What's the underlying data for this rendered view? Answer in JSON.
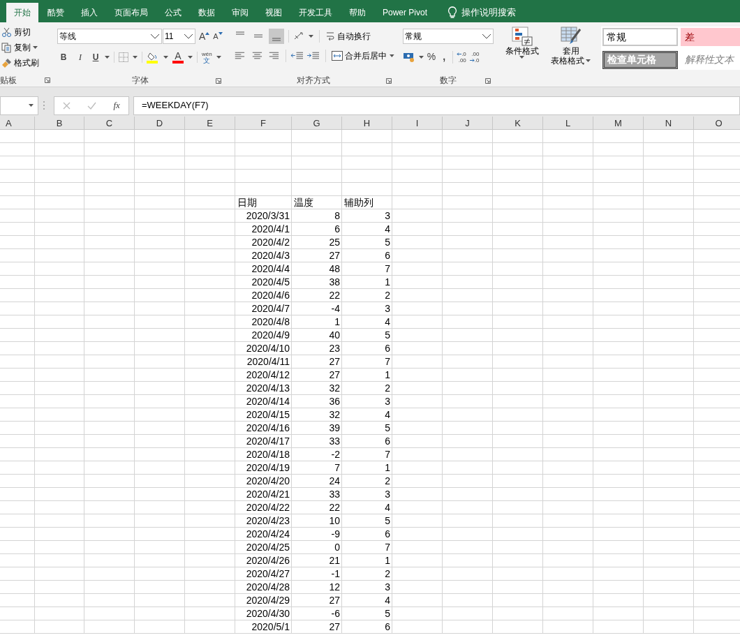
{
  "tabs": [
    {
      "label": "开始",
      "selected": true
    },
    {
      "label": "酷赞",
      "selected": false
    },
    {
      "label": "插入",
      "selected": false
    },
    {
      "label": "页面布局",
      "selected": false
    },
    {
      "label": "公式",
      "selected": false
    },
    {
      "label": "数据",
      "selected": false
    },
    {
      "label": "审阅",
      "selected": false
    },
    {
      "label": "视图",
      "selected": false
    },
    {
      "label": "开发工具",
      "selected": false
    },
    {
      "label": "帮助",
      "selected": false
    },
    {
      "label": "Power Pivot",
      "selected": false
    }
  ],
  "tell_me": "操作说明搜索",
  "clipboard": {
    "items": [
      "剪切",
      "复制",
      "格式刷"
    ],
    "label": "贴板"
  },
  "font": {
    "name": "等线",
    "size": "11",
    "grow": "A",
    "shrink": "A",
    "bold": "B",
    "italic": "I",
    "underline": "U",
    "font_color": "A",
    "phonetic_top": "wén",
    "phonetic_bottom": "文",
    "label": "字体"
  },
  "alignment": {
    "wrap": "自动换行",
    "merge": "合并后居中",
    "label": "对齐方式"
  },
  "number": {
    "format": "常规",
    "percent": "%",
    "comma": ",",
    "inc_top": ".0",
    "inc_bottom": ".00",
    "dec_top": ".00",
    "dec_bottom": ".0",
    "label": "数字"
  },
  "styles": {
    "conditional": "条件格式",
    "table_top": "套用",
    "table_bottom": "表格格式",
    "cells": [
      {
        "kind": "normal",
        "text": "常规"
      },
      {
        "kind": "bad",
        "text": "差"
      },
      {
        "kind": "check",
        "text": "检查单元格"
      },
      {
        "kind": "explanatory",
        "text": "解释性文本"
      }
    ]
  },
  "formula_bar": {
    "fx": "fx",
    "formula": "=WEEKDAY(F7)"
  },
  "columns": [
    "A",
    "B",
    "C",
    "D",
    "E",
    "F",
    "G",
    "H",
    "I",
    "J",
    "K",
    "L",
    "M",
    "N",
    "O"
  ],
  "header": [
    "日期",
    "温度",
    "辅助列"
  ],
  "rows": [
    [
      "2020/3/31",
      "8",
      "3"
    ],
    [
      "2020/4/1",
      "6",
      "4"
    ],
    [
      "2020/4/2",
      "25",
      "5"
    ],
    [
      "2020/4/3",
      "27",
      "6"
    ],
    [
      "2020/4/4",
      "48",
      "7"
    ],
    [
      "2020/4/5",
      "38",
      "1"
    ],
    [
      "2020/4/6",
      "22",
      "2"
    ],
    [
      "2020/4/7",
      "-4",
      "3"
    ],
    [
      "2020/4/8",
      "1",
      "4"
    ],
    [
      "2020/4/9",
      "40",
      "5"
    ],
    [
      "2020/4/10",
      "23",
      "6"
    ],
    [
      "2020/4/11",
      "27",
      "7"
    ],
    [
      "2020/4/12",
      "27",
      "1"
    ],
    [
      "2020/4/13",
      "32",
      "2"
    ],
    [
      "2020/4/14",
      "36",
      "3"
    ],
    [
      "2020/4/15",
      "32",
      "4"
    ],
    [
      "2020/4/16",
      "39",
      "5"
    ],
    [
      "2020/4/17",
      "33",
      "6"
    ],
    [
      "2020/4/18",
      "-2",
      "7"
    ],
    [
      "2020/4/19",
      "7",
      "1"
    ],
    [
      "2020/4/20",
      "24",
      "2"
    ],
    [
      "2020/4/21",
      "33",
      "3"
    ],
    [
      "2020/4/22",
      "22",
      "4"
    ],
    [
      "2020/4/23",
      "10",
      "5"
    ],
    [
      "2020/4/24",
      "-9",
      "6"
    ],
    [
      "2020/4/25",
      "0",
      "7"
    ],
    [
      "2020/4/26",
      "21",
      "1"
    ],
    [
      "2020/4/27",
      "-1",
      "2"
    ],
    [
      "2020/4/28",
      "12",
      "3"
    ],
    [
      "2020/4/29",
      "27",
      "4"
    ],
    [
      "2020/4/30",
      "-6",
      "5"
    ],
    [
      "2020/5/1",
      "27",
      "6"
    ]
  ]
}
